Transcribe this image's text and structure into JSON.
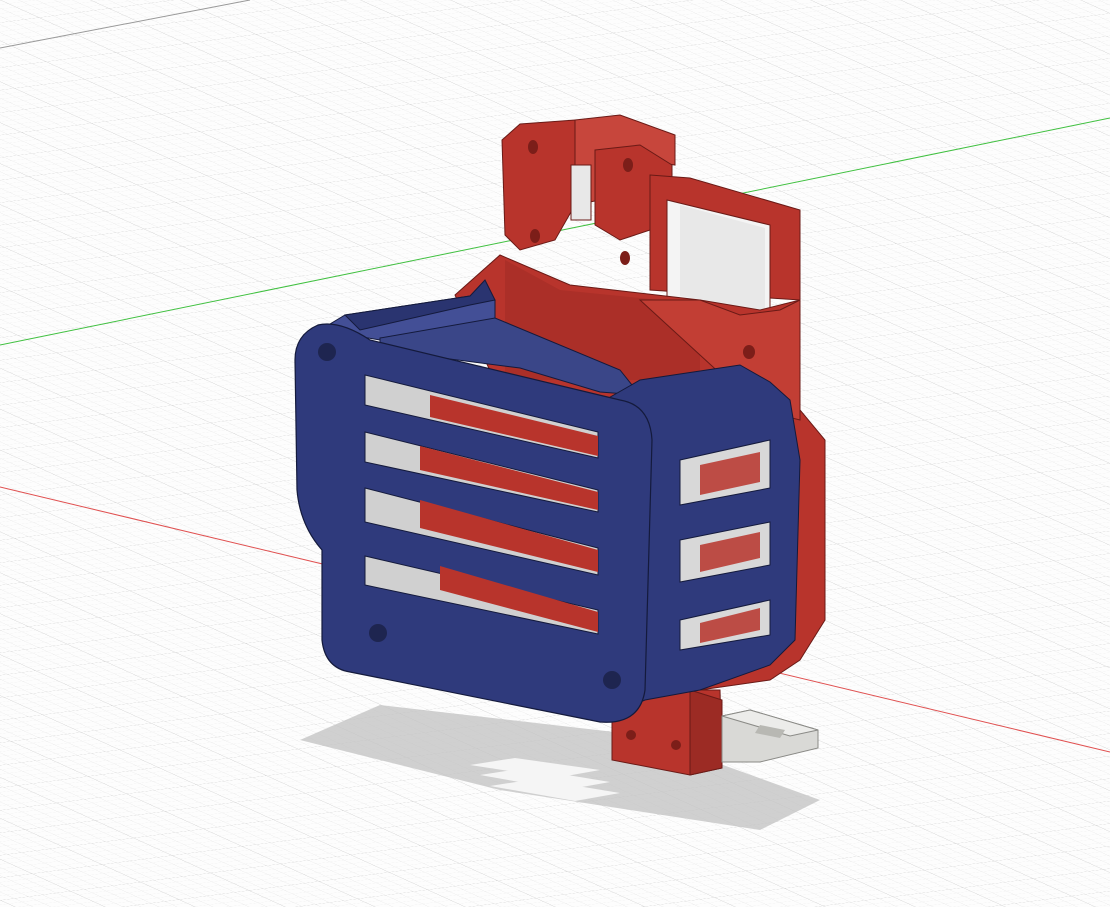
{
  "viewport": {
    "background": "#fdfdfd",
    "grid_minor_color": "#e3e3e3",
    "grid_major_color": "#cfcfcf",
    "x_axis_color": "#e05050",
    "y_axis_color": "#40c040",
    "shadow_color": "#bdbdbd"
  },
  "model": {
    "bodies": [
      {
        "name": "bracket-body",
        "color": "#b8342c",
        "color_dark": "#8e2620",
        "color_light": "#cf4a40"
      },
      {
        "name": "cage-body",
        "color": "#2f3a7c",
        "color_dark": "#222b5e",
        "color_light": "#434f96"
      },
      {
        "name": "clip-body",
        "color": "#d9d9d6",
        "color_dark": "#b8b8b3",
        "color_light": "#ececea"
      }
    ]
  }
}
